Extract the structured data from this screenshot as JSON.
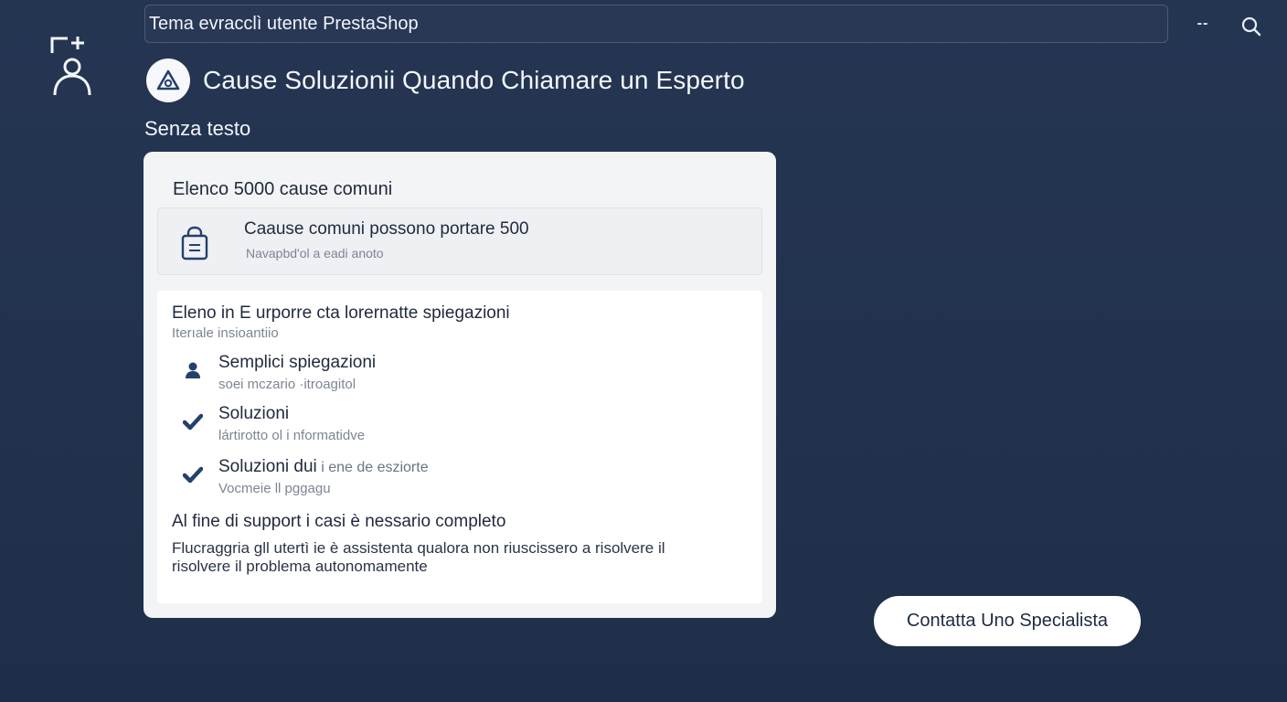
{
  "header": {
    "search_value": "Tema evracclì utente PrestaShop",
    "more_label": "--"
  },
  "page": {
    "title": "Cause Soluzionii Quando Chiamare un Esperto",
    "subtitle": "Senza testo"
  },
  "card": {
    "heading": "Elenco 5000 cause comuni",
    "causes_box": {
      "title": "Caause comuni possono portare 500",
      "subtitle": "Navapbd'ol a eadi anoto"
    },
    "list": {
      "heading": "Eleno in E urporre cta lorernatte spiegazioni",
      "subheading": "Iterıale insioantiio",
      "items": [
        {
          "icon": "user-icon",
          "title": "Semplici spiegazioni",
          "title_extra": "",
          "subtitle": "soei mczario ·itroagitol"
        },
        {
          "icon": "checkmark-icon",
          "title": "Soluzioni",
          "title_extra": "",
          "subtitle": "lártirotto ol i nformatidve"
        },
        {
          "icon": "checkmark-icon",
          "title": "Soluzioni dui",
          "title_extra": " i ene de esziorte",
          "subtitle": "Vocmeie ll pggagu"
        }
      ]
    },
    "final": {
      "heading": "Al fine di support i casi è nessario completo",
      "body": "Flucraggria gll utertì ie è assistenta qualora non riuscissero a risolvere il risolvere il problema autonomamente"
    }
  },
  "cta": {
    "label": "Contatta Uno Specialista"
  },
  "colors": {
    "background": "#22324e",
    "card": "#f3f4f6",
    "text_dark": "#1f2a3c",
    "accent_icon": "#25406b"
  }
}
